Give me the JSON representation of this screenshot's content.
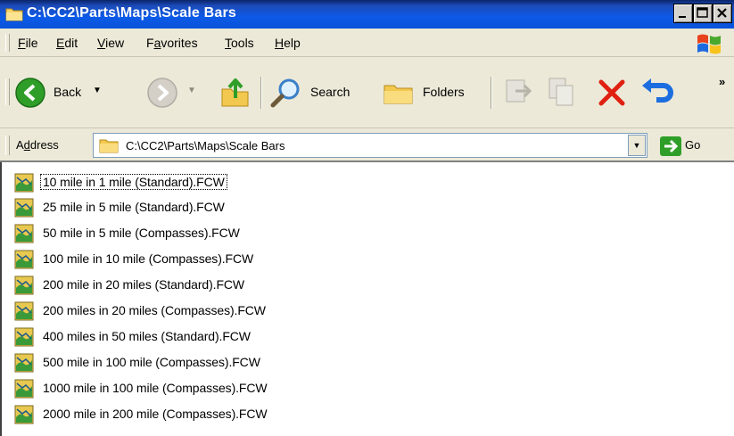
{
  "window": {
    "title": "C:\\CC2\\Parts\\Maps\\Scale Bars",
    "controls": {
      "minimize": "_",
      "maximize": "□",
      "close": "X"
    }
  },
  "menu": [
    {
      "label": "File"
    },
    {
      "label": "Edit"
    },
    {
      "label": "View"
    },
    {
      "label": "Favorites"
    },
    {
      "label": "Tools"
    },
    {
      "label": "Help"
    }
  ],
  "toolbar": {
    "back_label": "Back",
    "search_label": "Search",
    "folders_label": "Folders",
    "more_label": "»"
  },
  "address": {
    "label": "Address",
    "path": "C:\\CC2\\Parts\\Maps\\Scale Bars",
    "go_label": "Go"
  },
  "files": [
    {
      "name": "10 mile in 1 mile (Standard).FCW"
    },
    {
      "name": "25 mile in 5 mile (Standard).FCW"
    },
    {
      "name": "50 mile in 5 mile (Compasses).FCW"
    },
    {
      "name": "100 mile in 10 mile (Compasses).FCW"
    },
    {
      "name": "200 mile in 20 miles (Standard).FCW"
    },
    {
      "name": "200 miles in 20 miles (Compasses).FCW"
    },
    {
      "name": "400 miles in 50 miles (Standard).FCW"
    },
    {
      "name": "500 mile in 100 mile (Compasses).FCW"
    },
    {
      "name": "1000 mile in 100 mile (Compasses).FCW"
    },
    {
      "name": "2000 mile in 200 mile (Compasses).FCW"
    }
  ],
  "colors": {
    "titlebar": "#0a5ae8",
    "chrome": "#ece9d8",
    "back_green": "#2f9e28",
    "delete_red": "#e02010",
    "undo_blue": "#1c6ee0"
  }
}
